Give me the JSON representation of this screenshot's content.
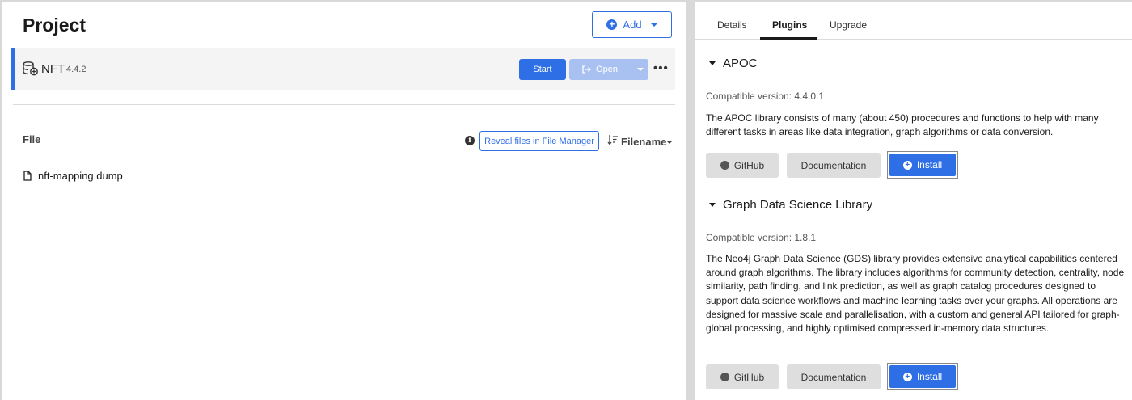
{
  "project": {
    "title": "Project",
    "add_label": "Add"
  },
  "database": {
    "name": "NFT",
    "version": "4.4.2",
    "start_label": "Start",
    "open_label": "Open",
    "more_label": "•••"
  },
  "files": {
    "heading": "File",
    "reveal_label": "Reveal files in File Manager",
    "sort_label": "Filename",
    "items": [
      {
        "name": "nft-mapping.dump"
      }
    ]
  },
  "tabs": [
    {
      "label": "Details"
    },
    {
      "label": "Plugins"
    },
    {
      "label": "Upgrade"
    }
  ],
  "plugins": [
    {
      "name": "APOC",
      "compat": "Compatible version: 4.4.0.1",
      "description": "The APOC library consists of many (about 450) procedures and functions to help with many different tasks in areas like data integration, graph algorithms or data conversion.",
      "github_label": "GitHub",
      "docs_label": "Documentation",
      "install_label": "Install"
    },
    {
      "name": "Graph Data Science Library",
      "compat": "Compatible version: 1.8.1",
      "description": "The Neo4j Graph Data Science (GDS) library provides extensive analytical capabilities centered around graph algorithms. The library includes algorithms for community detection, centrality, node similarity, path finding, and link prediction, as well as graph catalog procedures designed to support data science workflows and machine learning tasks over your graphs. All operations are designed for massive scale and parallelisation, with a custom and general API tailored for graph-global processing, and highly optimised compressed in-memory data structures.",
      "github_label": "GitHub",
      "docs_label": "Documentation",
      "install_label": "Install"
    }
  ],
  "colors": {
    "accent": "#2f6fe6",
    "accent_disabled": "#a9c1f1",
    "background": "#d9d9d9",
    "button_grey": "#dedede"
  }
}
